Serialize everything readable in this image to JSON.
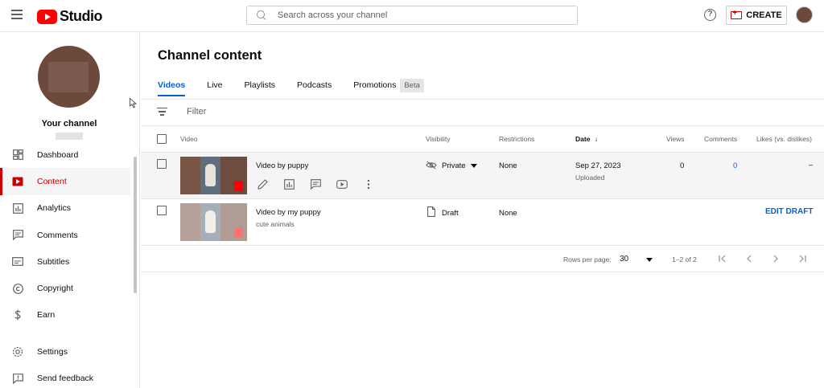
{
  "header": {
    "studio_label": "Studio",
    "search_placeholder": "Search across your channel",
    "help_glyph": "?",
    "create_label": "CREATE"
  },
  "sidebar": {
    "channel_label": "Your channel",
    "items": [
      {
        "label": "Dashboard",
        "icon": "dashboard-icon",
        "active": false
      },
      {
        "label": "Content",
        "icon": "content-icon",
        "active": true
      },
      {
        "label": "Analytics",
        "icon": "analytics-icon",
        "active": false
      },
      {
        "label": "Comments",
        "icon": "comments-icon",
        "active": false
      },
      {
        "label": "Subtitles",
        "icon": "subtitles-icon",
        "active": false
      },
      {
        "label": "Copyright",
        "icon": "copyright-icon",
        "active": false
      },
      {
        "label": "Earn",
        "icon": "earn-icon",
        "active": false
      },
      {
        "label": "Settings",
        "icon": "settings-icon",
        "active": false
      },
      {
        "label": "Send feedback",
        "icon": "feedback-icon",
        "active": false
      }
    ]
  },
  "main": {
    "title": "Channel content",
    "tabs": [
      {
        "label": "Videos",
        "active": true
      },
      {
        "label": "Live",
        "active": false
      },
      {
        "label": "Playlists",
        "active": false
      },
      {
        "label": "Podcasts",
        "active": false
      },
      {
        "label": "Promotions",
        "active": false
      }
    ],
    "beta_label": "Beta",
    "filter_placeholder": "Filter",
    "columns": {
      "video": "Video",
      "visibility": "Visibility",
      "restrictions": "Restrictions",
      "date": "Date",
      "date_sort": "↓",
      "views": "Views",
      "comments": "Comments",
      "likes": "Likes (vs. dislikes)"
    },
    "rows": [
      {
        "title": "Video by puppy",
        "description": "",
        "visibility": "Private",
        "restrictions": "None",
        "date": "Sep 27, 2023",
        "date_status": "Uploaded",
        "views": "0",
        "comments": "0",
        "likes": "–"
      },
      {
        "title": "Video by my puppy",
        "description": "cute animals",
        "visibility": "Draft",
        "restrictions": "None",
        "action": "EDIT DRAFT"
      }
    ],
    "pagination": {
      "rows_per_page_label": "Rows per page:",
      "rows_per_page_value": "30",
      "range": "1–2 of 2"
    }
  },
  "colors": {
    "accent_red": "#cc0000",
    "link_blue": "#065fd4",
    "row_highlight": "#f5f5f5"
  }
}
